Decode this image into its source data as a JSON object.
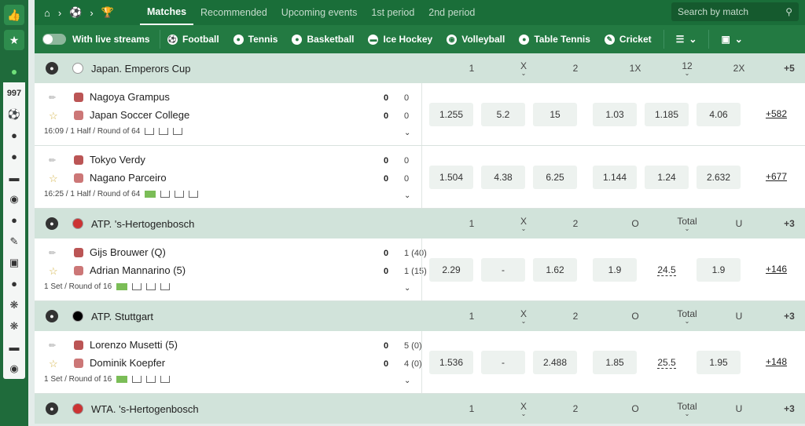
{
  "sidebar": {
    "live_count": "997",
    "icons": [
      "like-icon",
      "award-icon"
    ],
    "sports": [
      "football",
      "basketball",
      "basketball",
      "hockey",
      "volleyball",
      "table-tennis",
      "cricket",
      "esports",
      "tennis",
      "other",
      "other",
      "boat",
      "other"
    ]
  },
  "topbar": {
    "tabs": [
      "Matches",
      "Recommended",
      "Upcoming events",
      "1st period",
      "2nd period"
    ],
    "search_placeholder": "Search by match"
  },
  "sportbar": {
    "toggle_label": "With live streams",
    "sports": [
      "Football",
      "Tennis",
      "Basketball",
      "Ice Hockey",
      "Volleyball",
      "Table Tennis",
      "Cricket"
    ]
  },
  "leagues": [
    {
      "name": "Japan. Emperors Cup",
      "headers": [
        "1",
        "X",
        "2",
        "1X",
        "12",
        "2X"
      ],
      "more": "+5",
      "matches": [
        {
          "team1": "Nagoya Grampus",
          "team2": "Japan Soccer College",
          "score1": "0",
          "score1b": "0",
          "score2": "0",
          "score2b": "0",
          "info": "16:09 / 1 Half / Round of 64",
          "odds": [
            "1.255",
            "5.2",
            "15",
            "1.03",
            "1.185",
            "4.06"
          ],
          "more": "+582"
        },
        {
          "team1": "Tokyo Verdy",
          "team2": "Nagano Parceiro",
          "score1": "0",
          "score1b": "0",
          "score2": "0",
          "score2b": "0",
          "info": "16:25 / 1 Half / Round of 64",
          "odds": [
            "1.504",
            "4.38",
            "6.25",
            "1.144",
            "1.24",
            "2.632"
          ],
          "more": "+677"
        }
      ]
    },
    {
      "name": "ATP. 's-Hertogenbosch",
      "headers": [
        "1",
        "X",
        "2",
        "O",
        "Total",
        "U"
      ],
      "more": "+3",
      "matches": [
        {
          "team1": "Gijs Brouwer (Q)",
          "team2": "Adrian Mannarino (5)",
          "score1": "0",
          "score1b": "1 (40)",
          "score2": "0",
          "score2b": "1 (15)",
          "info": "1 Set / Round of 16",
          "odds": [
            "2.29",
            "-",
            "1.62",
            "1.9",
            "24.5",
            "1.9"
          ],
          "more": "+146"
        }
      ]
    },
    {
      "name": "ATP. Stuttgart",
      "headers": [
        "1",
        "X",
        "2",
        "O",
        "Total",
        "U"
      ],
      "more": "+3",
      "matches": [
        {
          "team1": "Lorenzo Musetti (5)",
          "team2": "Dominik Koepfer",
          "score1": "0",
          "score1b": "5 (0)",
          "score2": "0",
          "score2b": "4 (0)",
          "info": "1 Set / Round of 16",
          "odds": [
            "1.536",
            "-",
            "2.488",
            "1.85",
            "25.5",
            "1.95"
          ],
          "more": "+148"
        }
      ]
    },
    {
      "name": "WTA. 's-Hertogenbosch",
      "headers": [
        "1",
        "X",
        "2",
        "O",
        "Total",
        "U"
      ],
      "more": "+3",
      "matches": []
    }
  ]
}
